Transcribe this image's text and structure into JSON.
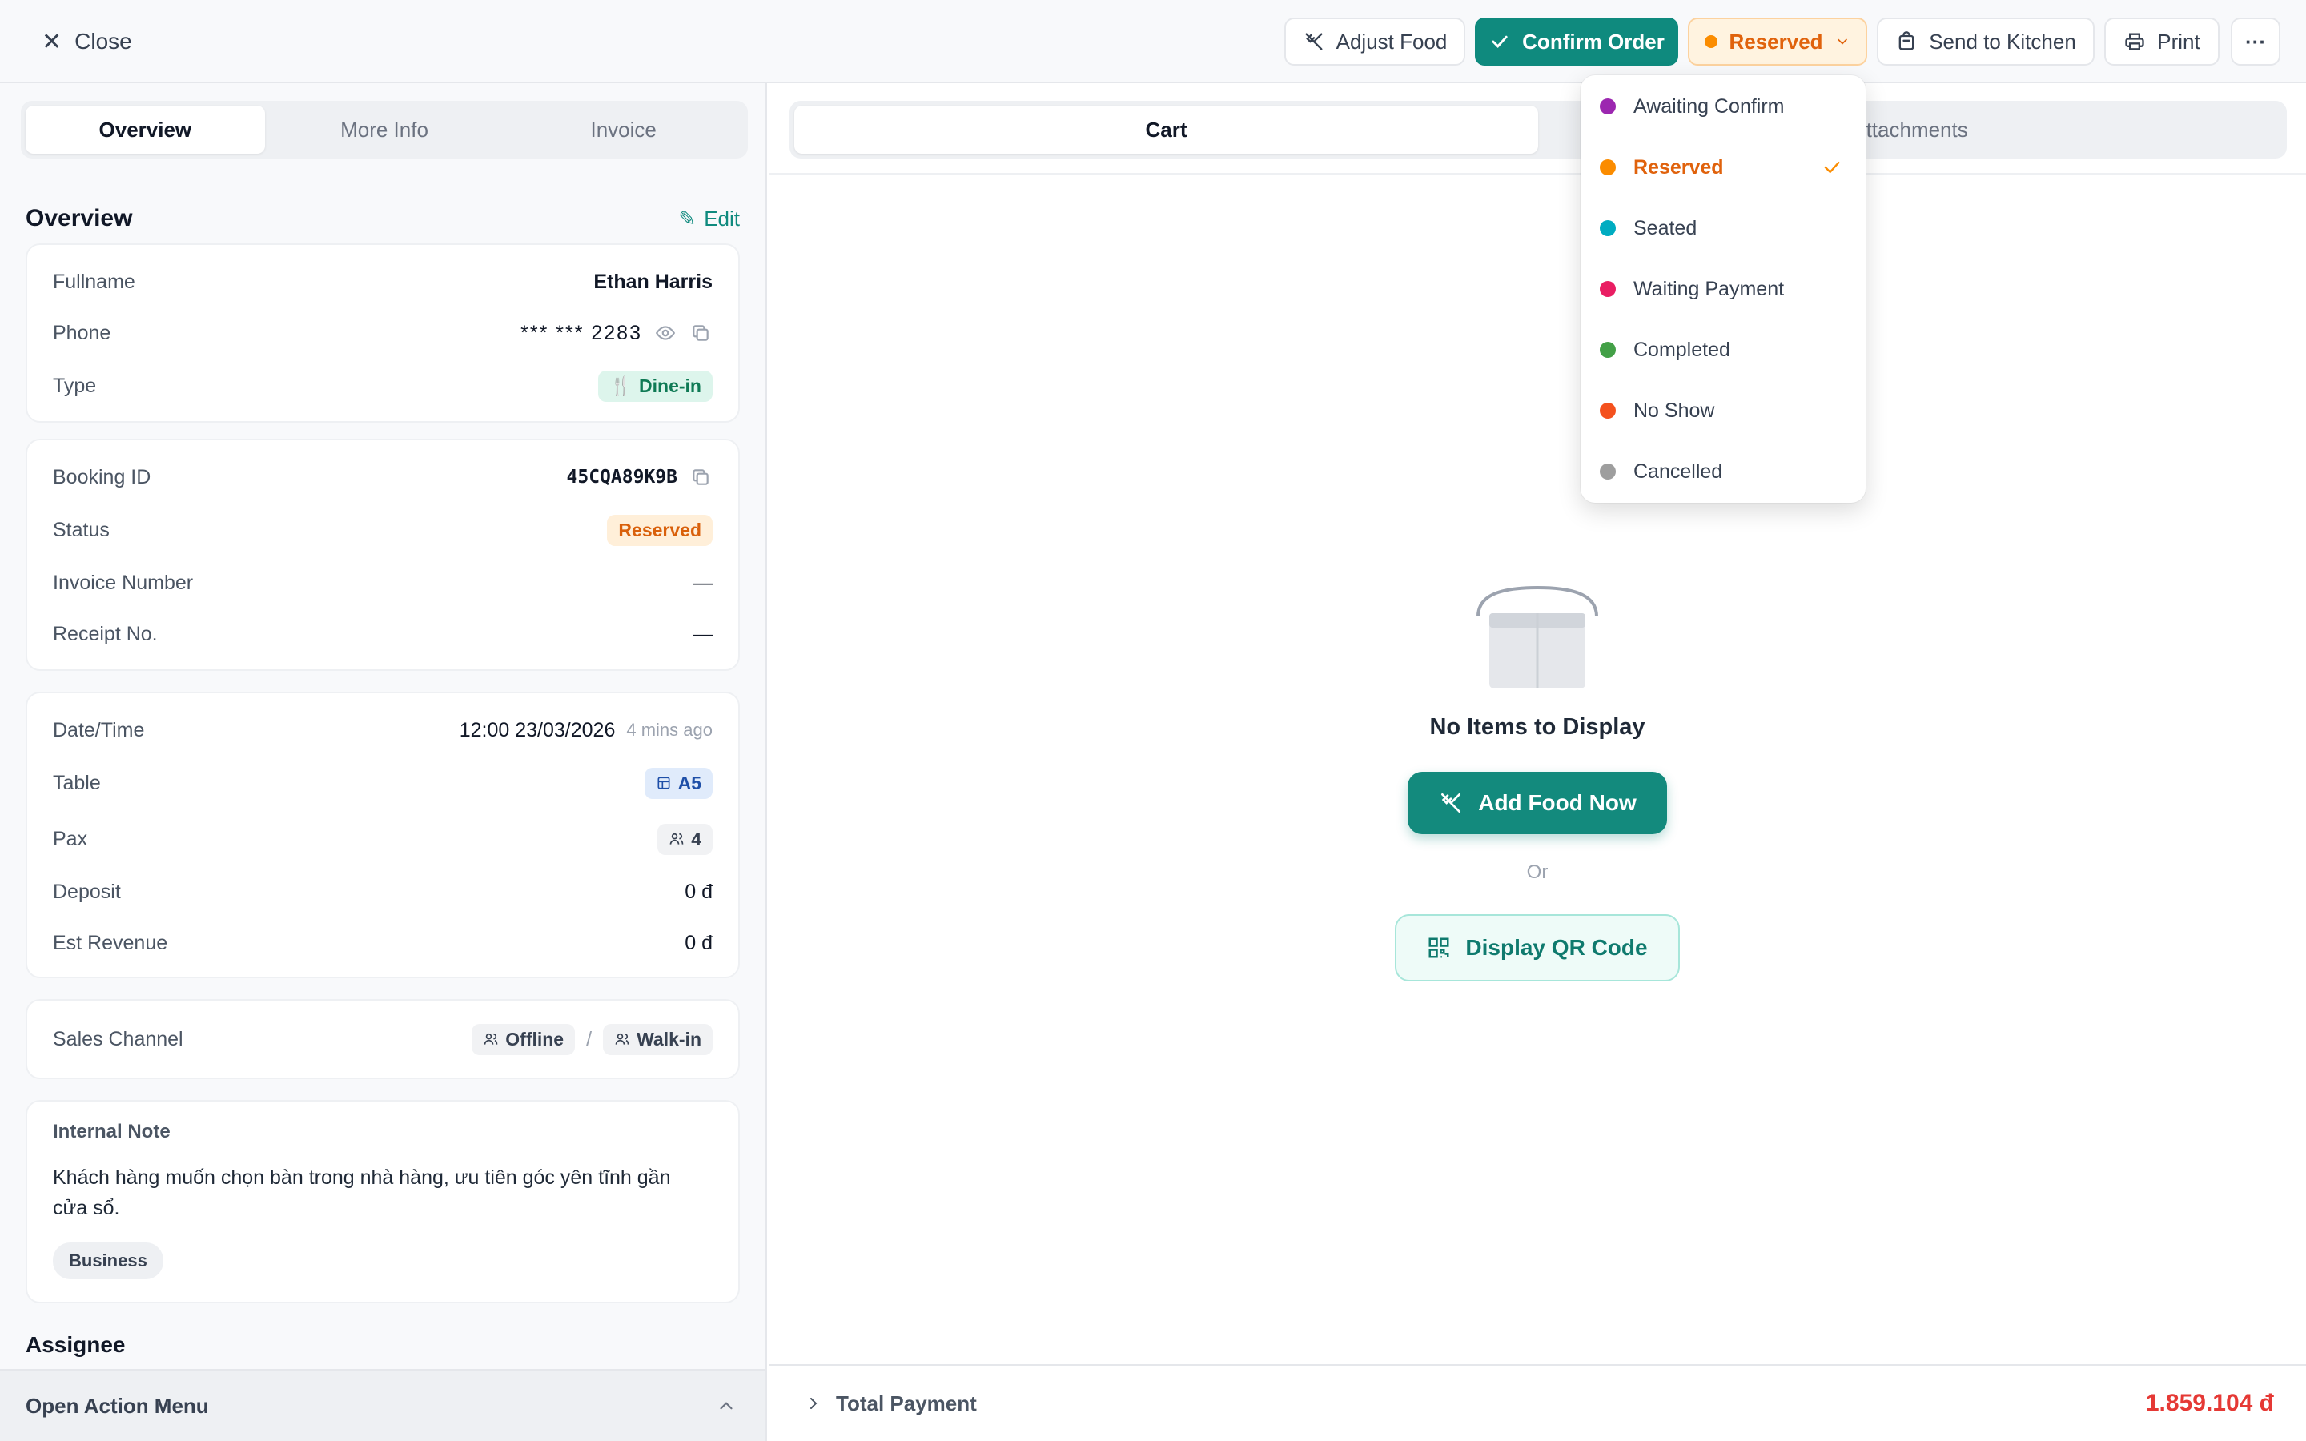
{
  "topbar": {
    "close_label": "Close",
    "adjust_food_label": "Adjust Food",
    "confirm_order_label": "Confirm Order",
    "status_label": "Reserved",
    "send_kitchen_label": "Send to Kitchen",
    "print_label": "Print",
    "more_label": "···"
  },
  "left_tabs": [
    "Overview",
    "More Info",
    "Invoice"
  ],
  "overview": {
    "title": "Overview",
    "edit_label": "Edit",
    "fullname_label": "Fullname",
    "fullname": "Ethan Harris",
    "phone_label": "Phone",
    "phone": "*** *** 2283",
    "type_label": "Type",
    "type": "Dine-in",
    "booking_id_label": "Booking ID",
    "booking_id": "45CQA89K9B",
    "status_label": "Status",
    "status": "Reserved",
    "invoice_number_label": "Invoice Number",
    "invoice_number": "—",
    "receipt_label": "Receipt No.",
    "receipt": "—",
    "datetime_label": "Date/Time",
    "datetime": "12:00 23/03/2026",
    "datetime_relative": "4 mins ago",
    "table_label": "Table",
    "table": "A5",
    "pax_label": "Pax",
    "pax": "4",
    "deposit_label": "Deposit",
    "deposit": "0 đ",
    "est_revenue_label": "Est Revenue",
    "est_revenue": "0 đ",
    "sales_channel_label": "Sales Channel",
    "channel_primary": "Offline",
    "channel_separator": "/",
    "channel_secondary": "Walk-in",
    "internal_note_label": "Internal Note",
    "internal_note": "Khách hàng muốn chọn bàn trong nhà hàng, ưu tiên góc yên tĩnh gần cửa sổ.",
    "note_tag": "Business",
    "assignee_title": "Assignee"
  },
  "action_menu_label": "Open Action Menu",
  "right_tabs": [
    "Cart",
    "Attachments"
  ],
  "empty_state": {
    "title": "No Items to Display",
    "add_food_label": "Add Food Now",
    "or_label": "Or",
    "qr_label": "Display QR Code"
  },
  "total": {
    "label": "Total Payment",
    "amount": "1.859.104 đ"
  },
  "status_menu": {
    "selected": "Reserved",
    "items": [
      {
        "label": "Awaiting Confirm",
        "color": "#9c27b0"
      },
      {
        "label": "Reserved",
        "color": "#fb8c00"
      },
      {
        "label": "Seated",
        "color": "#00acc1"
      },
      {
        "label": "Waiting Payment",
        "color": "#e91e63"
      },
      {
        "label": "Completed",
        "color": "#43a047"
      },
      {
        "label": "No Show",
        "color": "#f4511e"
      },
      {
        "label": "Cancelled",
        "color": "#9e9e9e"
      }
    ]
  },
  "colors": {
    "accent": "#0f8a7e",
    "status_orange": "#e0620c",
    "total_red": "#e53935"
  }
}
